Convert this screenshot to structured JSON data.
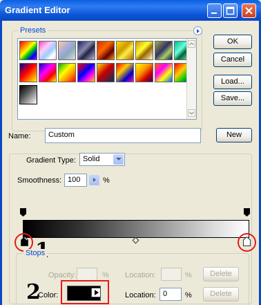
{
  "window": {
    "title": "Gradient Editor"
  },
  "presets": {
    "legend": "Presets"
  },
  "buttons": {
    "ok": "OK",
    "cancel": "Cancel",
    "load": "Load...",
    "save": "Save...",
    "new": "New",
    "delete_opacity": "Delete",
    "delete_color": "Delete"
  },
  "name_field": {
    "label": "Name:",
    "value": "Custom"
  },
  "gradient": {
    "type_label": "Gradient Type:",
    "type_value": "Solid",
    "smoothness_label": "Smoothness:",
    "smoothness_value": "100",
    "smoothness_unit": "%"
  },
  "stops": {
    "legend": "Stops",
    "opacity_label": "Opacity:",
    "opacity_unit": "%",
    "location_label": "Location:",
    "location_unit": "%",
    "color_label": "Color:",
    "color_location_value": "0",
    "color_location_unit": "%"
  },
  "annotations": {
    "marker_1": "1",
    "marker_2": "2"
  },
  "colors": {
    "title_blue": "#0a5fe0",
    "legend_blue": "#0046d5",
    "annotation_red": "#e21a1a"
  }
}
